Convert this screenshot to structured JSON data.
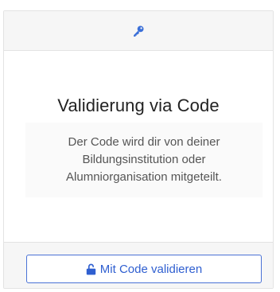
{
  "card": {
    "header_icon": "key-icon",
    "title": "Validierung via Code",
    "description": "Der Code wird dir von deiner Bildungsinstitution oder Alumniorganisation mitgeteilt.",
    "button_icon": "unlock-icon",
    "button_label": "Mit Code validieren"
  },
  "colors": {
    "accent": "#2f5fd0",
    "header_bg": "#f6f6f6",
    "border": "#e3e3e3"
  }
}
